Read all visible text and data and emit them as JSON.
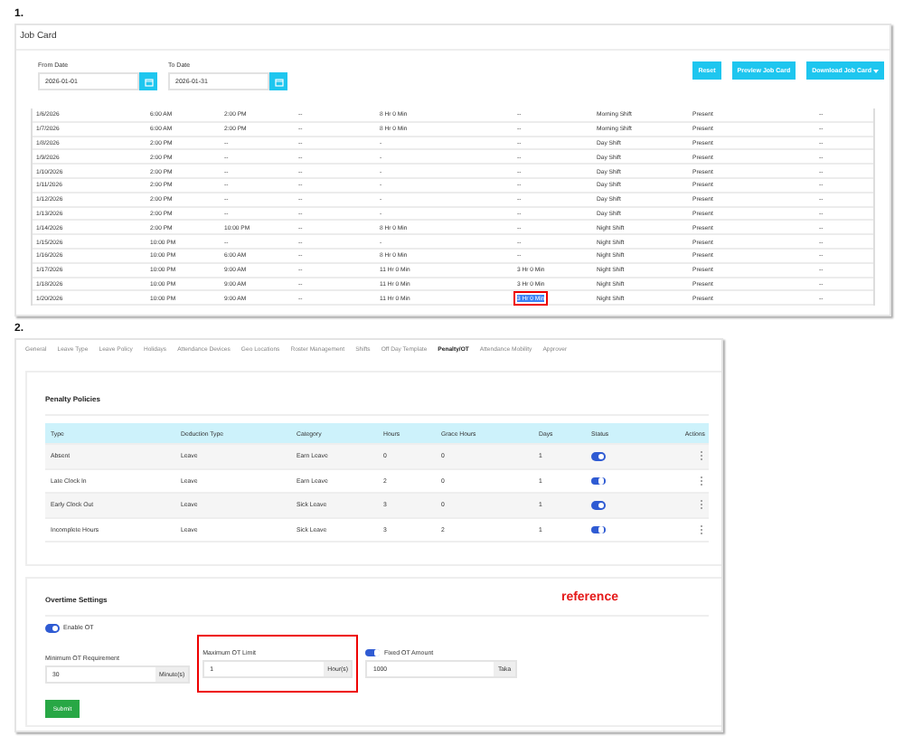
{
  "job_card": {
    "label": "1.",
    "title": "Job Card",
    "from_date": {
      "label": "From Date",
      "value": "2026-01-01"
    },
    "to_date": {
      "label": "To Date",
      "value": "2026-01-31"
    },
    "buttons": [
      {
        "label": "Reset",
        "kind": "plain"
      },
      {
        "label": "Preview Job Card",
        "kind": "plain"
      },
      {
        "label": "Download Job Card",
        "kind": "dropdown"
      }
    ],
    "rows": [
      {
        "cells": [
          "1/6/2026",
          "6:00 AM",
          "2:00 PM",
          "--",
          "8 Hr 0 Min",
          "--",
          "Morning Shift",
          "Present",
          "--"
        ],
        "annotated": false
      },
      {
        "cells": [
          "1/7/2026",
          "6:00 AM",
          "2:00 PM",
          "--",
          "8 Hr 0 Min",
          "--",
          "Morning Shift",
          "Present",
          "--"
        ],
        "annotated": false
      },
      {
        "cells": [
          "1/8/2026",
          "2:00 PM",
          "--",
          "--",
          "-",
          "--",
          "Day Shift",
          "Present",
          "--"
        ],
        "annotated": false
      },
      {
        "cells": [
          "1/9/2026",
          "2:00 PM",
          "--",
          "--",
          "-",
          "--",
          "Day Shift",
          "Present",
          "--"
        ],
        "annotated": false
      },
      {
        "cells": [
          "1/10/2026",
          "2:00 PM",
          "--",
          "--",
          "-",
          "--",
          "Day Shift",
          "Present",
          "--"
        ],
        "annotated": false
      },
      {
        "cells": [
          "1/11/2026",
          "2:00 PM",
          "--",
          "--",
          "-",
          "--",
          "Day Shift",
          "Present",
          "--"
        ],
        "annotated": false
      },
      {
        "cells": [
          "1/12/2026",
          "2:00 PM",
          "--",
          "--",
          "-",
          "--",
          "Day Shift",
          "Present",
          "--"
        ],
        "annotated": false
      },
      {
        "cells": [
          "1/13/2026",
          "2:00 PM",
          "--",
          "--",
          "-",
          "--",
          "Day Shift",
          "Present",
          "--"
        ],
        "annotated": false
      },
      {
        "cells": [
          "1/14/2026",
          "2:00 PM",
          "10:00 PM",
          "--",
          "8 Hr 0 Min",
          "--",
          "Night Shift",
          "Present",
          "--"
        ],
        "annotated": false
      },
      {
        "cells": [
          "1/15/2026",
          "10:00 PM",
          "--",
          "--",
          "-",
          "--",
          "Night Shift",
          "Present",
          "--"
        ],
        "annotated": false
      },
      {
        "cells": [
          "1/16/2026",
          "10:00 PM",
          "6:00 AM",
          "--",
          "8 Hr 0 Min",
          "--",
          "Night Shift",
          "Present",
          "--"
        ],
        "annotated": false
      },
      {
        "cells": [
          "1/17/2026",
          "10:00 PM",
          "9:00 AM",
          "--",
          "11 Hr 0 Min",
          "3 Hr 0 Min",
          "Night Shift",
          "Present",
          "--"
        ],
        "annotated": false
      },
      {
        "cells": [
          "1/18/2026",
          "10:00 PM",
          "9:00 AM",
          "--",
          "11 Hr 0 Min",
          "3 Hr 0 Min",
          "Night Shift",
          "Present",
          "--"
        ],
        "annotated": false
      },
      {
        "cells": [
          "1/20/2026",
          "10:00 PM",
          "9:00 AM",
          "--",
          "11 Hr 0 Min",
          "3 Hr 0 Min",
          "Night Shift",
          "Present",
          "--"
        ],
        "annotated": true
      }
    ]
  },
  "settings": {
    "label": "2.",
    "tabs": [
      {
        "label": "General",
        "selected": false
      },
      {
        "label": "Leave Type",
        "selected": false
      },
      {
        "label": "Leave Policy",
        "selected": false
      },
      {
        "label": "Holidays",
        "selected": false
      },
      {
        "label": "Attendance Devices",
        "selected": false
      },
      {
        "label": "Geo Locations",
        "selected": false
      },
      {
        "label": "Roster Management",
        "selected": false
      },
      {
        "label": "Shifts",
        "selected": false
      },
      {
        "label": "Off Day Template",
        "selected": false
      },
      {
        "label": "Penalty/OT",
        "selected": true
      },
      {
        "label": "Attendance Mobility",
        "selected": false
      },
      {
        "label": "Approver",
        "selected": false
      }
    ],
    "penalty_policies": {
      "title": "Penalty Policies",
      "columns": [
        "Type",
        "Deduction Type",
        "Category",
        "Hours",
        "Grace Hours",
        "Days",
        "Status",
        "Actions"
      ],
      "rows": [
        {
          "cells": [
            "Absent",
            "Leave",
            "Earn Leave",
            "0",
            "0",
            "1"
          ],
          "status_on": true
        },
        {
          "cells": [
            "Late Clock In",
            "Leave",
            "Earn Leave",
            "2",
            "0",
            "1"
          ],
          "status_on": true
        },
        {
          "cells": [
            "Early Clock Out",
            "Leave",
            "Sick Leave",
            "3",
            "0",
            "1"
          ],
          "status_on": true
        },
        {
          "cells": [
            "Incomplete Hours",
            "Leave",
            "Sick Leave",
            "3",
            "2",
            "1"
          ],
          "status_on": true
        }
      ]
    },
    "overtime": {
      "title": "Overtime Settings",
      "annotation": "reference",
      "enable_ot": {
        "label": "Enable OT",
        "on": true
      },
      "fields": [
        {
          "kind": "plain",
          "label": "Minimum OT Requirement",
          "value": "30",
          "unit": "Minute(s)",
          "annotated": false
        },
        {
          "kind": "plain",
          "label": "Maximum OT Limit",
          "value": "1",
          "unit": "Hour(s)",
          "annotated": true
        },
        {
          "kind": "toggle",
          "label": "Fixed OT Amount",
          "on": true,
          "value": "1000",
          "unit": "Taka",
          "annotated": false
        }
      ],
      "submit": "Submit"
    }
  }
}
